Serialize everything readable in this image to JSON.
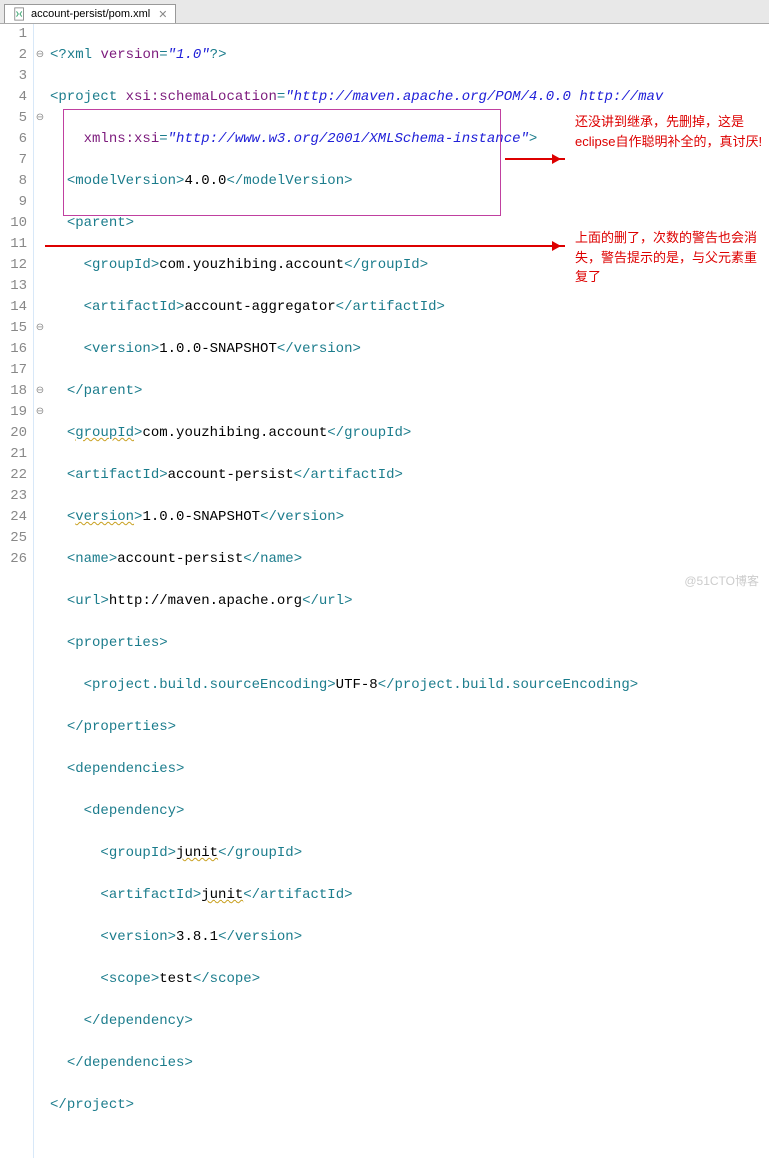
{
  "tab": {
    "label": "account-persist/pom.xml",
    "close": "✕"
  },
  "fold": [
    "",
    "⊖",
    "",
    "",
    "⊖",
    "",
    "",
    "",
    "",
    "",
    "",
    "",
    "",
    "",
    "⊖",
    "",
    "",
    "⊖",
    "⊖",
    "",
    "",
    "",
    "",
    "",
    "",
    ""
  ],
  "warnings": {
    "10": true,
    "11": true,
    "12": true
  },
  "annotations": {
    "note1": "还没讲到继承，先删掉，这是eclipse自作聪明补全的，真讨厌!",
    "note2": "上面的删了，次数的警告也会消失，警告提示的是，与父元素重复了"
  },
  "watermark": "@51CTO博客",
  "code": {
    "l1": {
      "p": "<?",
      "t1": "xml",
      "a1": "version",
      "v1": "\"1.0\"",
      "s": "?>"
    },
    "l2": {
      "t": "project",
      "a1": "xsi:schemaLocation",
      "v1": "\"http://maven.apache.org/POM/4.0.0 http://mav"
    },
    "l3": {
      "a1": "xmlns:xsi",
      "v1": "\"http://www.w3.org/2001/XMLSchema-instance\""
    },
    "l4": {
      "t": "modelVersion",
      "txt": "4.0.0"
    },
    "l5": {
      "t": "parent"
    },
    "l6": {
      "t": "groupId",
      "txt": "com.youzhibing.account"
    },
    "l7": {
      "t": "artifactId",
      "txt": "account-aggregator"
    },
    "l8": {
      "t": "version",
      "txt": "1.0.0-SNAPSHOT"
    },
    "l9": {
      "t": "parent"
    },
    "l10": {
      "t": "groupId",
      "txt": "com.youzhibing.account"
    },
    "l11": {
      "t": "artifactId",
      "txt": "account-persist"
    },
    "l12": {
      "t": "version",
      "txt": "1.0.0-SNAPSHOT"
    },
    "l13": {
      "t": "name",
      "txt": "account-persist"
    },
    "l14": {
      "t": "url",
      "txt": "http://maven.apache.org"
    },
    "l15": {
      "t": "properties"
    },
    "l16": {
      "t": "project.build.sourceEncoding",
      "txt": "UTF-8"
    },
    "l17": {
      "t": "properties"
    },
    "l18": {
      "t": "dependencies"
    },
    "l19": {
      "t": "dependency"
    },
    "l20": {
      "t": "groupId",
      "txt": "junit"
    },
    "l21": {
      "t": "artifactId",
      "txt": "junit"
    },
    "l22": {
      "t": "version",
      "txt": "3.8.1"
    },
    "l23": {
      "t": "scope",
      "txt": "test"
    },
    "l24": {
      "t": "dependency"
    },
    "l25": {
      "t": "dependencies"
    },
    "l26": {
      "t": "project"
    }
  }
}
